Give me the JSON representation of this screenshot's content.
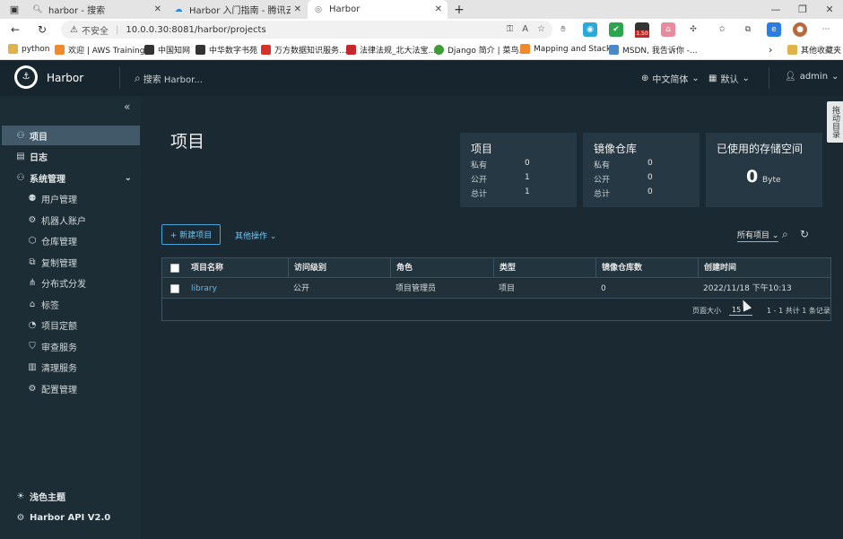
{
  "browser": {
    "tabs": [
      {
        "title": "harbor - 搜索",
        "icon": "search-icon"
      },
      {
        "title": "Harbor 入门指南 - 腾讯云开发者",
        "icon": "cloud-icon"
      },
      {
        "title": "Harbor",
        "icon": "globe-icon"
      }
    ],
    "url_warning": "不安全",
    "url": "10.0.0.30:8081/harbor/projects",
    "badge": "1.50",
    "bookmarks": [
      {
        "label": "python",
        "color": "#e0b34a"
      },
      {
        "label": "欢迎 | AWS Training...",
        "color": "#f0892b"
      },
      {
        "label": "中国知网",
        "color": "#333333"
      },
      {
        "label": "中华数字书苑",
        "color": "#333333"
      },
      {
        "label": "万方数据知识服务...",
        "color": "#d9322b"
      },
      {
        "label": "法律法规_北大法宝...",
        "color": "#c4272c"
      },
      {
        "label": "Django 简介 | 菜鸟...",
        "color": "#3e9c35"
      },
      {
        "label": "Mapping and Stack...",
        "color": "#f0892b"
      },
      {
        "label": "MSDN, 我告诉你 -...",
        "color": "#4a88cc"
      }
    ],
    "other_bookmarks": "其他收藏夹"
  },
  "header": {
    "brand": "Harbor",
    "search_placeholder": "搜索 Harbor...",
    "language": "中文简体",
    "theme_default": "默认",
    "user": "admin"
  },
  "sidebar": {
    "items": [
      {
        "label": "项目",
        "icon": "projects-icon",
        "active": true
      },
      {
        "label": "日志",
        "icon": "logs-icon"
      },
      {
        "label": "系统管理",
        "icon": "admin-icon"
      }
    ],
    "sub_items": [
      {
        "label": "用户管理",
        "icon": "users-icon"
      },
      {
        "label": "机器人账户",
        "icon": "robot-icon"
      },
      {
        "label": "仓库管理",
        "icon": "registry-icon"
      },
      {
        "label": "复制管理",
        "icon": "replication-icon"
      },
      {
        "label": "分布式分发",
        "icon": "distribution-icon"
      },
      {
        "label": "标签",
        "icon": "tag-icon"
      },
      {
        "label": "项目定额",
        "icon": "quota-icon"
      },
      {
        "label": "审查服务",
        "icon": "shield-icon"
      },
      {
        "label": "清理服务",
        "icon": "trash-icon"
      },
      {
        "label": "配置管理",
        "icon": "gear-icon"
      }
    ],
    "theme": "浅色主题",
    "api": "Harbor API V2.0"
  },
  "main": {
    "title": "项目",
    "cards": {
      "projects": {
        "title": "项目",
        "private_label": "私有",
        "private": "0",
        "public_label": "公开",
        "public": "1",
        "total_label": "总计",
        "total": "1"
      },
      "repos": {
        "title": "镜像仓库",
        "private_label": "私有",
        "private": "0",
        "public_label": "公开",
        "public": "0",
        "total_label": "总计",
        "total": "0"
      },
      "storage": {
        "title": "已使用的存储空间",
        "value": "0",
        "unit": "Byte"
      }
    },
    "new_project": "+ 新建项目",
    "more_actions": "其他操作",
    "filter": "所有项目",
    "columns": [
      "项目名称",
      "访问级别",
      "角色",
      "类型",
      "镜像仓库数",
      "创建时间"
    ],
    "rows": [
      {
        "name": "library",
        "access": "公开",
        "role": "项目管理员",
        "type": "项目",
        "repo_count": "0",
        "created": "2022/11/18 下午10:13"
      }
    ],
    "page_size_label": "页面大小",
    "page_size": "15",
    "page_info": "1 - 1 共计 1 条记录"
  },
  "side_tab": "拖动目录"
}
